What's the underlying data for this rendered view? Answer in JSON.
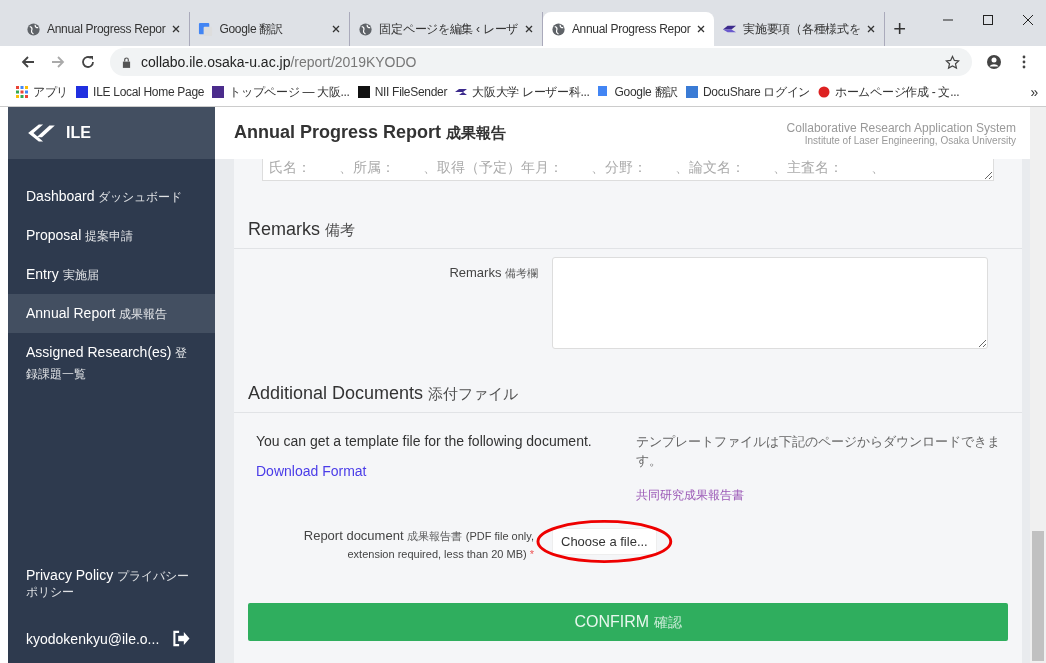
{
  "browser": {
    "tabs": [
      {
        "title": "Annual Progress Repor",
        "selected": false
      },
      {
        "title": "Google 翻訳",
        "selected": false
      },
      {
        "title": "固定ページを編集 ‹ レーザ",
        "selected": false
      },
      {
        "title": "Annual Progress Repor",
        "selected": true
      },
      {
        "title": "実施要項（各種様式を",
        "selected": false
      }
    ],
    "new_tab": "+",
    "url_host": "collabo.ile.osaka-u.ac.jp",
    "url_path": "/report/2019KYODO",
    "apps": "アプリ",
    "bookmarks": [
      "ILE Local Home Page",
      "トップページ — 大阪...",
      "NII FileSender",
      "大阪大学 レーザー科...",
      "Google 翻訳",
      "DocuShare ログイン",
      "ホームページ作成 - 文..."
    ],
    "overflow": "»"
  },
  "sidebar": {
    "brand": "ILE",
    "items": [
      {
        "en": "Dashboard",
        "ja": "ダッシュボード",
        "selected": false
      },
      {
        "en": "Proposal",
        "ja": "提案申請",
        "selected": false
      },
      {
        "en": "Entry",
        "ja": "実施届",
        "selected": false
      },
      {
        "en": "Annual Report",
        "ja": "成果報告",
        "selected": true
      },
      {
        "en": "Assigned Research(es)",
        "ja": "登録課題一覧",
        "selected": false
      }
    ],
    "privacy": {
      "en": "Privacy Policy",
      "ja": "プライバシーポリシー"
    },
    "user": "kyodokenkyu@ile.o..."
  },
  "header": {
    "title_en": "Annual Progress Report",
    "title_ja": "成果報告",
    "system": "Collaborative Research Application System",
    "institute": "Institute of Laser Engineering, Osaka University"
  },
  "top_field": {
    "placeholder": "氏名：　　、所属：　　、取得（予定）年月：　　、分野：　　、論文名：　　、主査名：　　、"
  },
  "remarks": {
    "heading_en": "Remarks",
    "heading_ja": "備考",
    "label_en": "Remarks",
    "label_ja": "備考欄"
  },
  "documents": {
    "heading_en": "Additional Documents",
    "heading_ja": "添付ファイル",
    "template_en": "You can get a template file for the following document.",
    "download_link": "Download Format",
    "template_ja": "テンプレートファイルは下記のページからダウンロードできます。",
    "ja_link": "共同研究成果報告書",
    "report_en": "Report document",
    "report_ja": "成果報告書",
    "report_note_1": "(PDF file only,",
    "report_note_2": "extension required, less than 20 MB)",
    "required": "*",
    "file_button": "Choose a file..."
  },
  "confirm": {
    "en": "CONFIRM",
    "ja": "確認"
  }
}
